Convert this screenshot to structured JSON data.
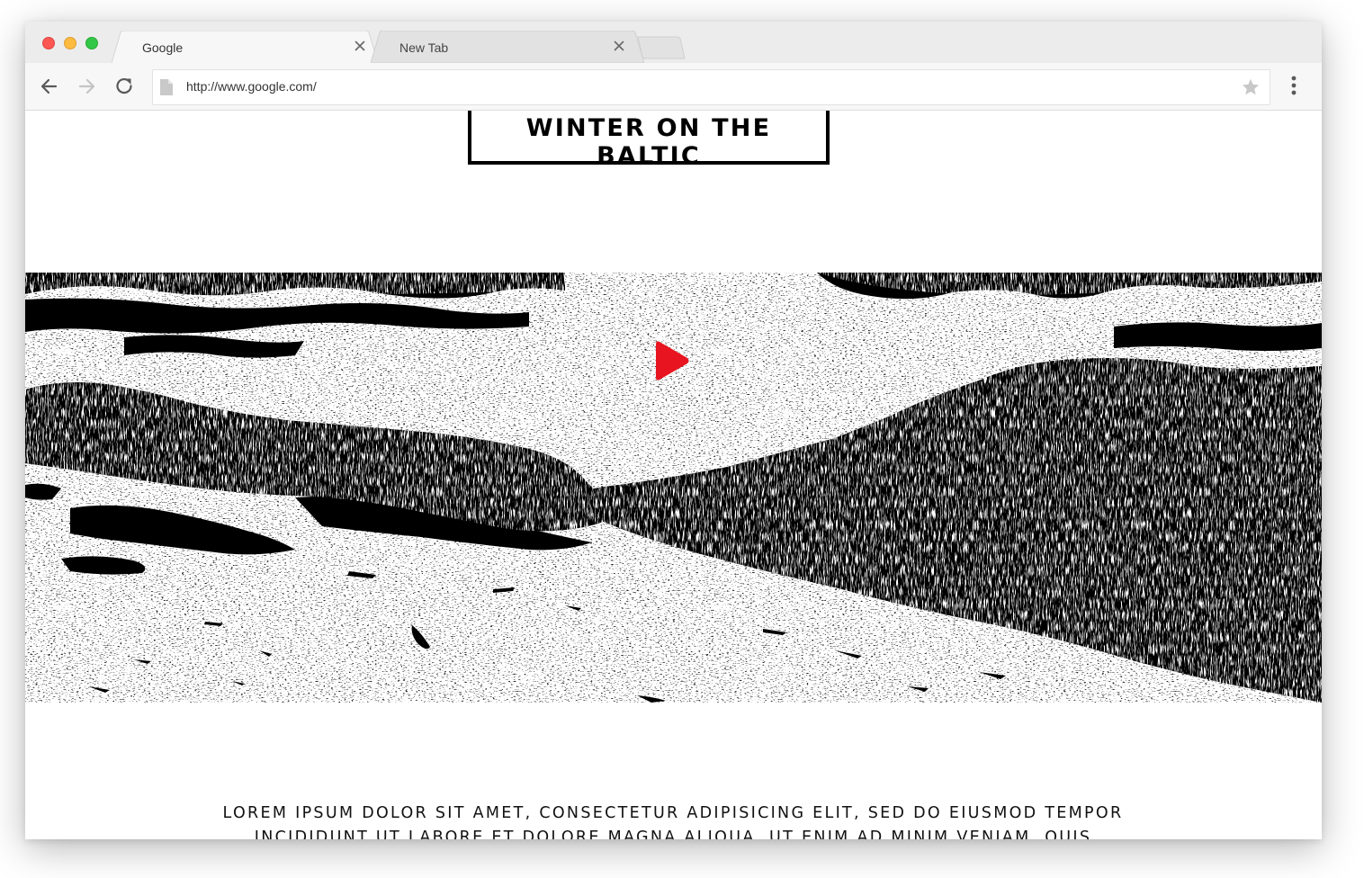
{
  "browser": {
    "tabs": [
      {
        "title": "Google",
        "active": true
      },
      {
        "title": "New Tab",
        "active": false
      }
    ],
    "address_bar": {
      "url": "http://www.google.com/"
    },
    "icons": {
      "back": "arrow-left-icon",
      "forward": "arrow-right-icon",
      "reload": "reload-icon",
      "page": "document-icon",
      "bookmark": "star-icon",
      "menu": "vertical-dots-icon",
      "close": "close-icon"
    },
    "colors": {
      "close_dot": "#fc5753",
      "minimize_dot": "#fdbc40",
      "maximize_dot": "#33c748"
    }
  },
  "page": {
    "title": "WINTER ON THE BALTIC",
    "hero": {
      "image": "black-and-white coastal rocks and ice",
      "play_icon": "play-icon",
      "play_color": "#e8141f"
    },
    "body_text": "LOREM IPSUM DOLOR SIT AMET, CONSECTETUR ADIPISICING ELIT, SED DO EIUSMOD TEMPOR INCIDIDUNT UT LABORE ET DOLORE MAGNA ALIQUA. UT ENIM AD MINIM VENIAM, QUIS"
  }
}
